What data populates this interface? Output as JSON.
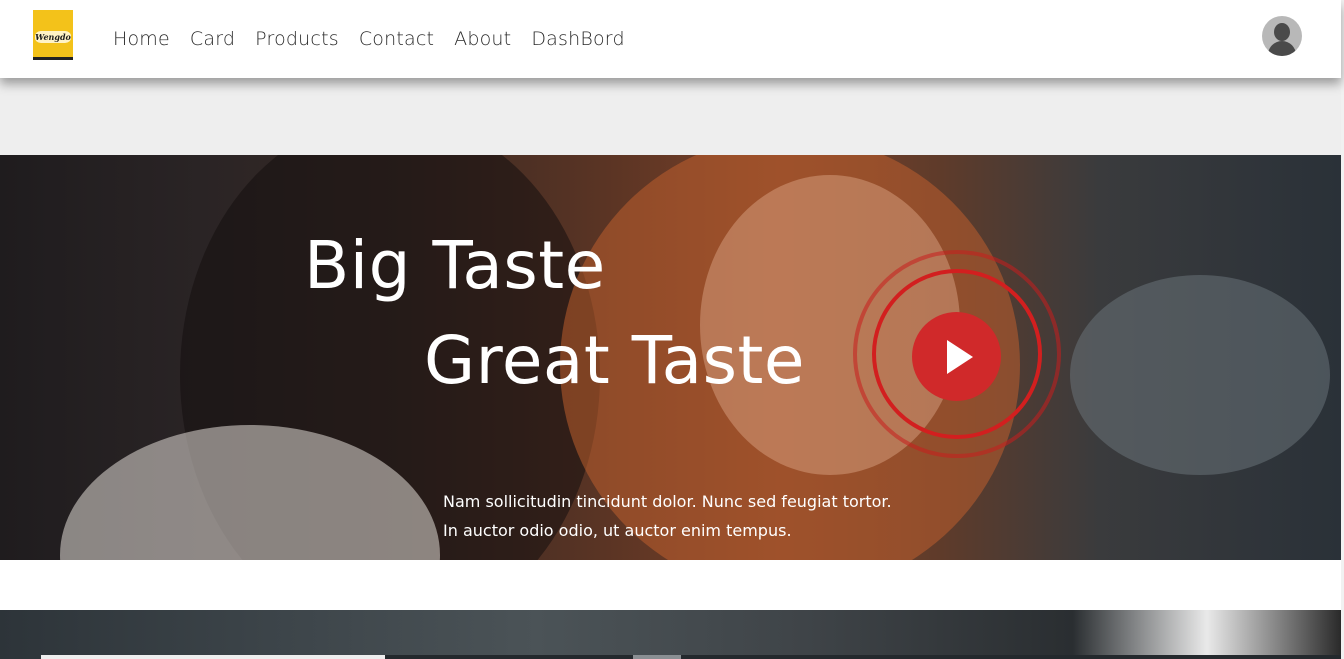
{
  "logo": {
    "text": "Wengdo",
    "color": "#f3c21a"
  },
  "nav": {
    "items": [
      {
        "label": "Home"
      },
      {
        "label": "Card"
      },
      {
        "label": "Products"
      },
      {
        "label": "Contact"
      },
      {
        "label": "About"
      },
      {
        "label": "DashBord"
      }
    ]
  },
  "user": {
    "avatar_icon": "user-silhouette-icon"
  },
  "hero": {
    "title_line_1": "Big Taste",
    "title_line_2": "Great Taste",
    "subtitle_line_1": "Nam sollicitudin tincidunt dolor. Nunc sed feugiat tortor.",
    "subtitle_line_2": "In auctor odio odio, ut auctor enim tempus.",
    "play_icon": "play-icon",
    "accent_color": "#d0292a"
  }
}
